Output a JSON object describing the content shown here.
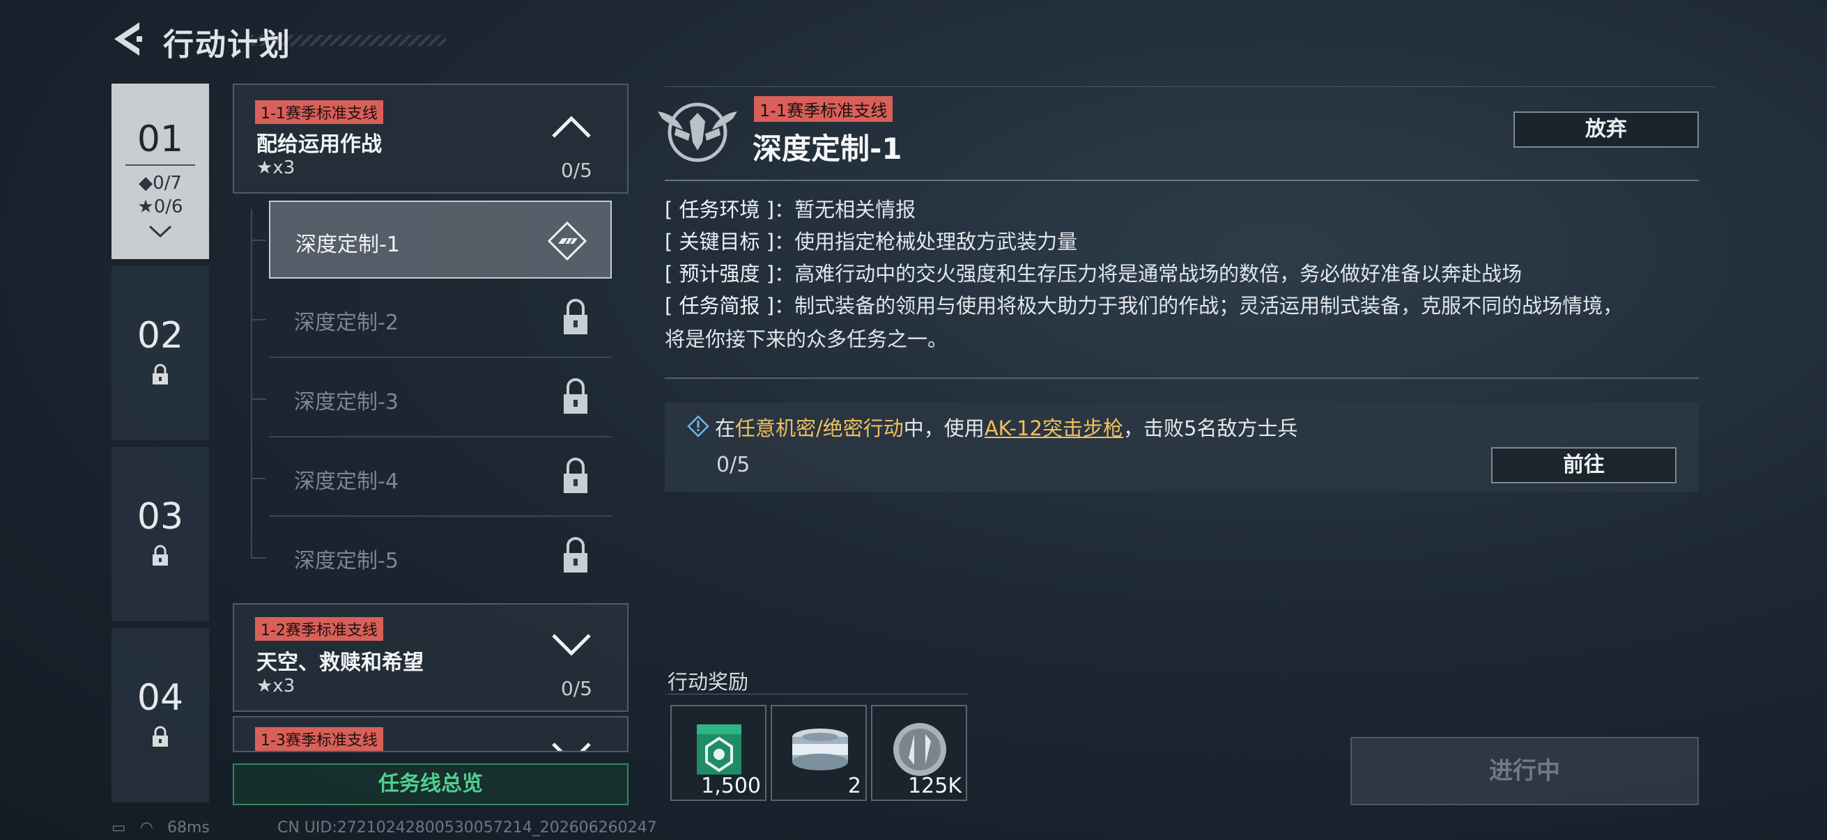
{
  "header": {
    "title": "行动计划"
  },
  "chapters": [
    {
      "num": "01",
      "diamonds": "◆0/7",
      "stars": "★0/6",
      "active": true
    },
    {
      "num": "02",
      "locked": true
    },
    {
      "num": "03",
      "locked": true
    },
    {
      "num": "04",
      "locked": true
    }
  ],
  "missions": [
    {
      "tag": "1-1赛季标准支线",
      "name": "配给运用作战",
      "stars": "★x3",
      "progress": "0/5",
      "expanded": true
    },
    {
      "tag": "1-2赛季标准支线",
      "name": "天空、救赎和希望",
      "stars": "★x3",
      "progress": "0/5",
      "expanded": false
    },
    {
      "tag": "1-3赛季标准支线"
    }
  ],
  "sub_missions": [
    {
      "label": "深度定制-1",
      "state": "active"
    },
    {
      "label": "深度定制-2",
      "state": "locked"
    },
    {
      "label": "深度定制-3",
      "state": "locked"
    },
    {
      "label": "深度定制-4",
      "state": "locked"
    },
    {
      "label": "深度定制-5",
      "state": "locked"
    }
  ],
  "overview_button": "任务线总览",
  "detail": {
    "tag": "1-1赛季标准支线",
    "title": "深度定制-1",
    "abandon": "放弃",
    "info": [
      {
        "key": "[ 任务环境 ]",
        "value": "：暂无相关情报"
      },
      {
        "key": "[ 关键目标 ]",
        "value": "：使用指定枪械处理敌方武装力量"
      },
      {
        "key": "[ 预计强度 ]",
        "value": "：高难行动中的交火强度和生存压力将是通常战场的数倍，务必做好准备以奔赴战场"
      },
      {
        "key": "[ 任务简报 ]",
        "value": "：制式装备的领用与使用将极大助力于我们的作战；灵活运用制式装备，克服不同的战场情境，"
      }
    ],
    "info_continuation": "将是你接下来的众多任务之一。",
    "task": {
      "prefix": "在",
      "mode": "任意机密/绝密行动",
      "middle": "中，使用",
      "weapon": "AK-12突击步枪",
      "suffix": "，击败5名敌方士兵",
      "progress": "0/5",
      "goto": "前往"
    },
    "rewards_label": "行动奖励",
    "rewards": [
      {
        "icon": "green-crate-icon",
        "count": "1,500"
      },
      {
        "icon": "tin-can-icon",
        "count": "2"
      },
      {
        "icon": "silver-coin-icon",
        "count": "125K"
      }
    ],
    "status_button": "进行中"
  },
  "footer": {
    "latency": "68ms",
    "uid": "CN UID:27210242800530057214_202606260247"
  },
  "colors": {
    "tag_red": "#d9605a",
    "highlight_yellow": "#f0c060",
    "overview_green": "#4fd08e"
  }
}
